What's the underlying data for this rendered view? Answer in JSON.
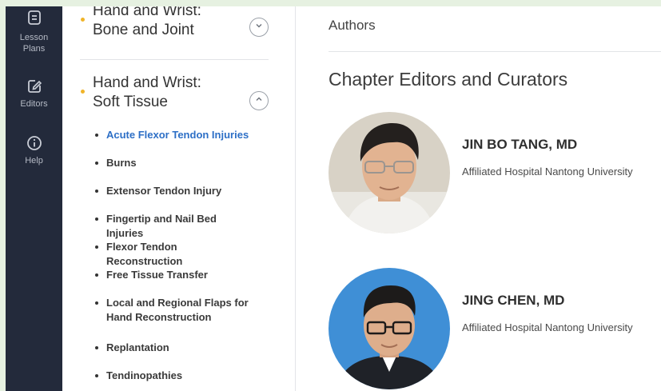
{
  "rail": {
    "items": [
      {
        "label_line1": "Lesson",
        "label_line2": "Plans",
        "icon": "lesson-plans-icon"
      },
      {
        "label_line1": "Editors",
        "icon": "editors-icon"
      },
      {
        "label_line1": "Help",
        "icon": "help-icon"
      }
    ]
  },
  "sidebar": {
    "sections": [
      {
        "title": "Hand and Wrist: Bone and Joint",
        "expanded": false
      },
      {
        "title": "Hand and Wrist: Soft Tissue",
        "expanded": true
      }
    ],
    "topics": [
      "Acute Flexor Tendon Injuries",
      "Burns",
      "Extensor Tendon Injury",
      "Fingertip and Nail Bed Injuries",
      "Flexor Tendon Reconstruction",
      "Free Tissue Transfer",
      "Local and Regional Flaps for Hand Reconstruction",
      "Replantation",
      "Tendinopathies"
    ],
    "active_topic": "Acute Flexor Tendon Injuries"
  },
  "main": {
    "authors_label": "Authors",
    "chapter_heading": "Chapter Editors and Curators",
    "editors": [
      {
        "name": "JIN BO TANG, MD",
        "affiliation": "Affiliated Hospital Nantong University"
      },
      {
        "name": "JING CHEN, MD",
        "affiliation": "Affiliated Hospital Nantong University"
      }
    ]
  },
  "colors": {
    "rail_bg": "#232a3b",
    "accent_dot": "#f0b429",
    "active_link": "#2d6fc6",
    "outer_bg": "#e6f1e1"
  }
}
